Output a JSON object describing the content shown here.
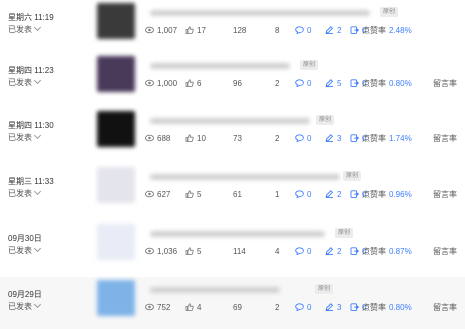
{
  "tag_original": "原创",
  "rows": [
    {
      "date": "星期六 11:19",
      "status": "已发表",
      "views": "1,007",
      "likes": "17",
      "c3": "128",
      "c4": "8",
      "comments": "0",
      "edits": "2",
      "shares": "0",
      "ratio_label": "点赞率",
      "ratio_value": "2.48%",
      "extra_label": "",
      "thumb": "#3a3a3a"
    },
    {
      "date": "星期四 11:23",
      "status": "已发表",
      "views": "1,000",
      "likes": "6",
      "c3": "96",
      "c4": "2",
      "comments": "0",
      "edits": "5",
      "shares": "0",
      "ratio_label": "点赞率",
      "ratio_value": "0.80%",
      "extra_label": "留言率",
      "thumb": "#4a3a5a"
    },
    {
      "date": "星期四 11:30",
      "status": "已发表",
      "views": "688",
      "likes": "10",
      "c3": "73",
      "c4": "2",
      "comments": "0",
      "edits": "3",
      "shares": "0",
      "ratio_label": "点赞率",
      "ratio_value": "1.74%",
      "extra_label": "留言率",
      "thumb": "#111111"
    },
    {
      "date": "星期三 11:33",
      "status": "已发表",
      "views": "627",
      "likes": "5",
      "c3": "61",
      "c4": "1",
      "comments": "0",
      "edits": "2",
      "shares": "0",
      "ratio_label": "点赞率",
      "ratio_value": "0.96%",
      "extra_label": "留言率",
      "thumb": "#e4e4ec"
    },
    {
      "date": "09月30日",
      "status": "已发表",
      "views": "1,036",
      "likes": "5",
      "c3": "114",
      "c4": "4",
      "comments": "0",
      "edits": "2",
      "shares": "0",
      "ratio_label": "点赞率",
      "ratio_value": "0.87%",
      "extra_label": "留言率",
      "thumb": "#e8ecf6"
    },
    {
      "date": "09月29日",
      "status": "已发表",
      "views": "752",
      "likes": "4",
      "c3": "69",
      "c4": "2",
      "comments": "0",
      "edits": "3",
      "shares": "0",
      "ratio_label": "点赞率",
      "ratio_value": "0.80%",
      "extra_label": "留言率",
      "thumb": "#7fb3e8"
    }
  ]
}
